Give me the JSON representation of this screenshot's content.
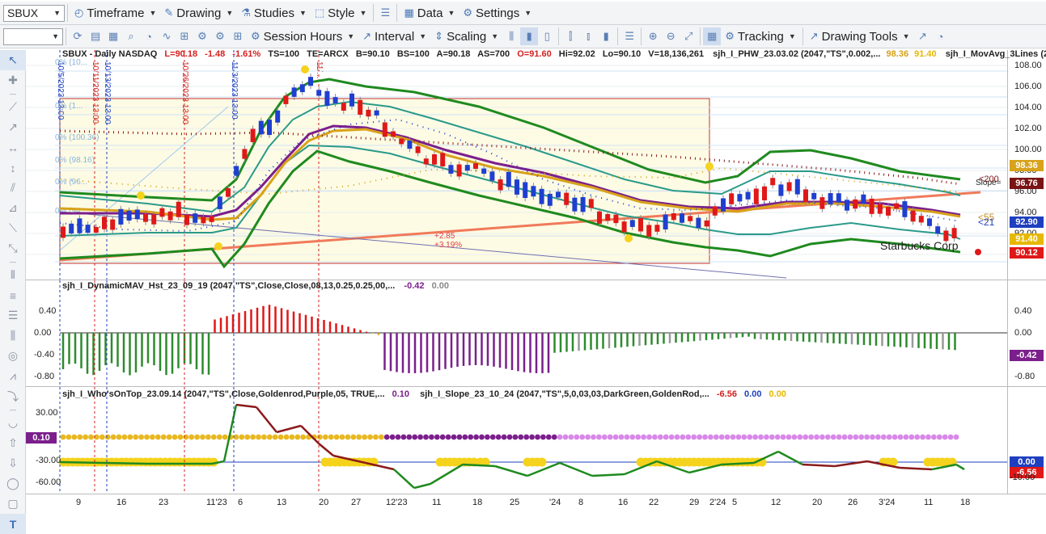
{
  "toolbar1": {
    "symbol": "SBUX",
    "timeframe": "Timeframe",
    "drawing": "Drawing",
    "studies": "Studies",
    "style": "Style",
    "data": "Data",
    "settings": "Settings"
  },
  "toolbar2": {
    "session_hours": "Session Hours",
    "interval": "Interval",
    "scaling": "Scaling",
    "tracking": "Tracking",
    "drawing_tools": "Drawing Tools"
  },
  "price_pane": {
    "header": {
      "symbol_line": "SBUX - Daily  NASDAQ",
      "last": "L=90.18",
      "chg": "-1.48",
      "pct": "-1.61%",
      "ts": "TS=100",
      "te": "TE=ARCX",
      "b": "B=90.10",
      "bs": "BS=100",
      "a": "A=90.18",
      "as": "AS=700",
      "o": "O=91.60",
      "hi": "Hi=92.02",
      "lo": "Lo=90.10",
      "v": "V=18,136,261",
      "study1": "sjh_I_PHW_23.03.02 (2047,\"TS\",0.002,...",
      "study1_v1": "98.36",
      "study1_v2": "91.40",
      "study2": "sjh_I_MovAvg_3Lines (204..."
    },
    "ticks": [
      "108.00",
      "106.00",
      "104.00",
      "102.00",
      "100.00",
      "98.00",
      "96.00",
      "94.00",
      "92.00",
      "90.00"
    ],
    "badges": {
      "b1": "98.36",
      "b1_color": "#d8a21a",
      "b2": "96.76",
      "b2_color": "#7a1414",
      "b3": "92.90",
      "b3_color": "#1e3fbf",
      "b4": "91.40",
      "b4_color": "#e6b800",
      "b5": "90.12",
      "b5_color": "#e01818"
    },
    "labels": {
      "starbucks": "Starbucks Corp",
      "slope": "Slope=",
      "s200": "<200",
      "s55": "<55",
      "s21": "<21",
      "box_pct": "+2.85",
      "box_pct2": "+3.19%"
    },
    "vlines": [
      "10/5/2023 13:00",
      "10/11/2023 13:00",
      "10/13/2023 13:00",
      "10/26/2023 13:00",
      "11/3/2023 13:00",
      "11/..."
    ],
    "fib": [
      "0% (10...",
      "0% (1...",
      "0% (100.36)",
      "0% (98.16)",
      "0% (96...",
      "0% (94..."
    ]
  },
  "hist_pane": {
    "title": "sjh_I_DynamicMAV_Hst_23_09_19 (2047,\"TS\",Close,Close,08,13,0.25,0.25,00,...",
    "v1": "-0.42",
    "v2": "0.00",
    "ticks": [
      "0.40",
      "0.00",
      "-0.40",
      "-0.80"
    ],
    "badge": "-0.42",
    "badge_color": "#7b1f8c"
  },
  "osc_pane": {
    "title1": "sjh_I_Who'sOnTop_23.09.14 (2047,\"TS\",Close,Goldenrod,Purple,05,  TRUE,...",
    "t1v": "0.10",
    "title2": "sjh_I_Slope_23_10_24 (2047,\"TS\",5,0,03,03,DarkGreen,GoldenRod,...",
    "t2v1": "-6.56",
    "t2v2": "0.00",
    "t2v3": "0.00",
    "ticks_l": [
      "30.00",
      "0.10",
      "-30.00",
      "-60.00"
    ],
    "ticks_r": [
      "0.00",
      "-6.56",
      "-10.00"
    ],
    "badge_l": "0.10",
    "badge_r1": "0.00",
    "badge_r2": "-6.56"
  },
  "x_axis": [
    "9",
    "16",
    "23",
    "11'23",
    "6",
    "13",
    "20",
    "27",
    "12'23",
    "11",
    "18",
    "25",
    "'24",
    "8",
    "16",
    "22",
    "29",
    "2'24",
    "5",
    "12",
    "20",
    "26",
    "3'24",
    "11",
    "18"
  ]
}
